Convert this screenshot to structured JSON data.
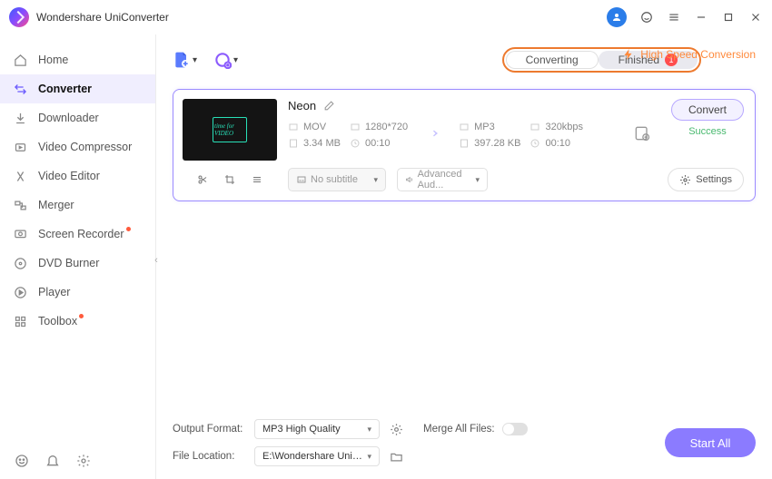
{
  "app": {
    "title": "Wondershare UniConverter"
  },
  "sidebar": {
    "items": [
      {
        "label": "Home"
      },
      {
        "label": "Converter"
      },
      {
        "label": "Downloader"
      },
      {
        "label": "Video Compressor"
      },
      {
        "label": "Video Editor"
      },
      {
        "label": "Merger"
      },
      {
        "label": "Screen Recorder"
      },
      {
        "label": "DVD Burner"
      },
      {
        "label": "Player"
      },
      {
        "label": "Toolbox"
      }
    ]
  },
  "tabs": {
    "converting": "Converting",
    "finished": "Finished",
    "finished_count": "1"
  },
  "hsc": "High Speed Conversion",
  "file": {
    "name": "Neon",
    "src": {
      "format": "MOV",
      "res": "1280*720",
      "size": "3.34 MB",
      "dur": "00:10"
    },
    "dst": {
      "format": "MP3",
      "bitrate": "320kbps",
      "size": "397.28 KB",
      "dur": "00:10"
    },
    "subtitle_placeholder": "No subtitle",
    "audio_label": "Advanced Aud...",
    "settings_label": "Settings",
    "convert_label": "Convert",
    "status": "Success",
    "thumb_text": "time for\nVIDEO"
  },
  "footer": {
    "output_format_label": "Output Format:",
    "output_format_value": "MP3 High Quality",
    "file_location_label": "File Location:",
    "file_location_value": "E:\\Wondershare UniConverter",
    "merge_label": "Merge All Files:",
    "start_all": "Start All"
  }
}
